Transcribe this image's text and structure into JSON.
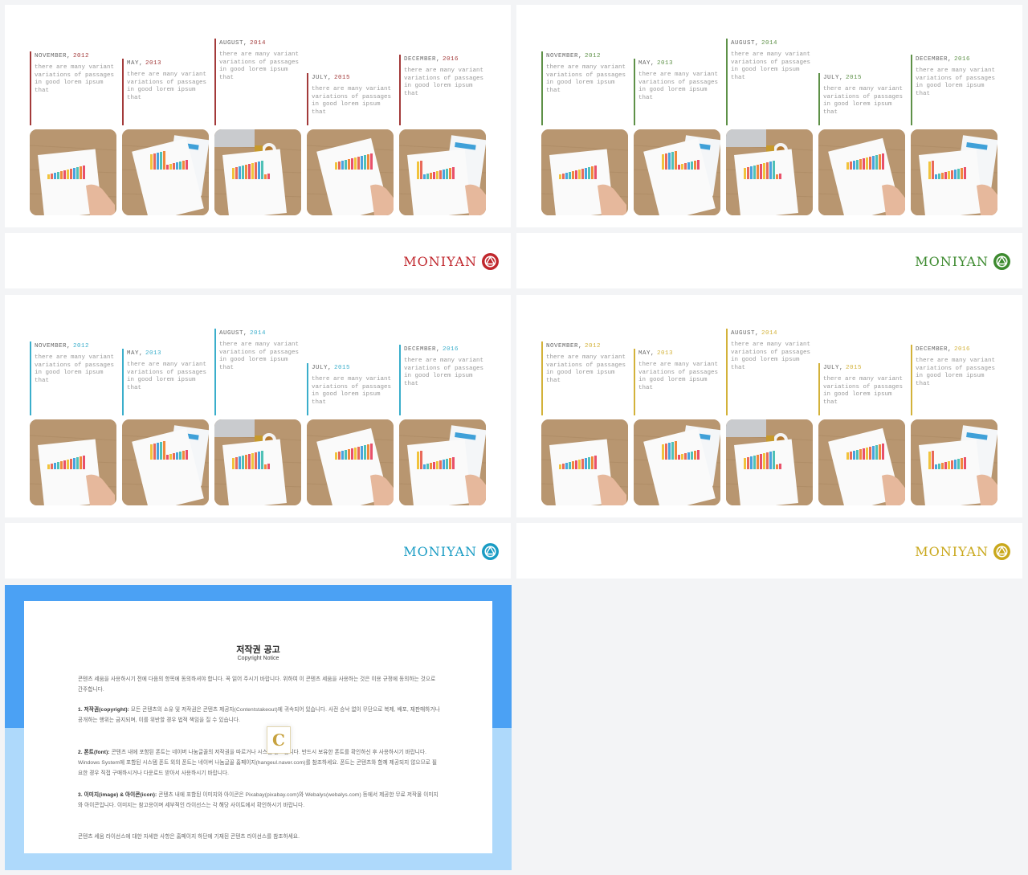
{
  "timeline": {
    "items": [
      {
        "month": "NOVEMBER,",
        "year": "2012",
        "text": "there are many variant variations of passages in good lorem ipsum that"
      },
      {
        "month": "MAY,",
        "year": "2013",
        "text": "there are many variant variations of passages in good lorem ipsum that"
      },
      {
        "month": "AUGUST,",
        "year": "2014",
        "text": "there are many variant variations of passages in good lorem ipsum that"
      },
      {
        "month": "JULY,",
        "year": "2015",
        "text": "there are many variant variations of passages in good lorem ipsum that"
      },
      {
        "month": "DECEMBER,",
        "year": "2016",
        "text": "there are many variant variations of passages in good lorem ipsum that"
      }
    ]
  },
  "brand": {
    "name": "MONIYAN"
  },
  "themes": [
    {
      "name": "red",
      "accent": "#a33a3a",
      "logo": "#c0272d"
    },
    {
      "name": "green",
      "accent": "#5e9148",
      "logo": "#3d8a2f"
    },
    {
      "name": "cyan",
      "accent": "#3aaecb",
      "logo": "#1a9cc4"
    },
    {
      "name": "yellow",
      "accent": "#d3b23a",
      "logo": "#c9a81c"
    }
  ],
  "notice": {
    "title": "저작권 공고",
    "subtitle": "Copyright Notice",
    "intro": "콘텐츠 세움을 사용하시기 전에 다음의 항목에 동의하셔야 합니다. 꼭 읽어 주시기 바랍니다. 위하여 이 콘텐츠 세움을 사용하는 것은 이용 규정에 동의하는 것으로 간주합니다.",
    "p1_head": "1. 저작권(copyright):",
    "p1_body": "모든 콘텐츠의 소유 및 저작권은 콘텐츠 제공자(Contentstakeout)에 귀속되어 있습니다. 사전 승낙 없이 무단으로 복제, 배포, 재판매하거나 공개하는 행위는 금지되며, 이를 위반할 경우 법적 책임을 질 수 있습니다.",
    "p2_head": "2. 폰트(font):",
    "p2_body": "콘텐츠 내에 포함된 폰트는 네이버 나눔글꼴의 저작권을 따르거나 시스템 폰트입니다. 반드시 보유한 폰트를 확인하신 후 사용하시기 바랍니다. Windows System에 포함된 시스템 폰트 외의 폰트는 네이버 나눔글꼴 홈페이지(hangeul.naver.com)를 참조하세요. 폰트는 콘텐츠와 함께 제공되지 않으므로 필요한 경우 직접 구매하시거나 다운로드 받아서 사용하시기 바랍니다.",
    "p3_head": "3. 이미지(image) & 아이콘(icon):",
    "p3_body": "콘텐츠 내에 포함된 이미지와 아이콘은 Pixabay(pixabay.com)와 Webalys(webalys.com) 등에서 제공한 무료 저작물 이미지와 아이콘입니다. 이미지는 참고용이며 세부적인 라이선스는 각 해당 사이트에서 확인하시기 바랍니다.",
    "outro": "콘텐츠 세움 라이선스에 대한 자세한 사항은 홈페이지 하단에 기재된 콘텐츠 라이선스를 참조하세요.",
    "stamp": "C"
  }
}
